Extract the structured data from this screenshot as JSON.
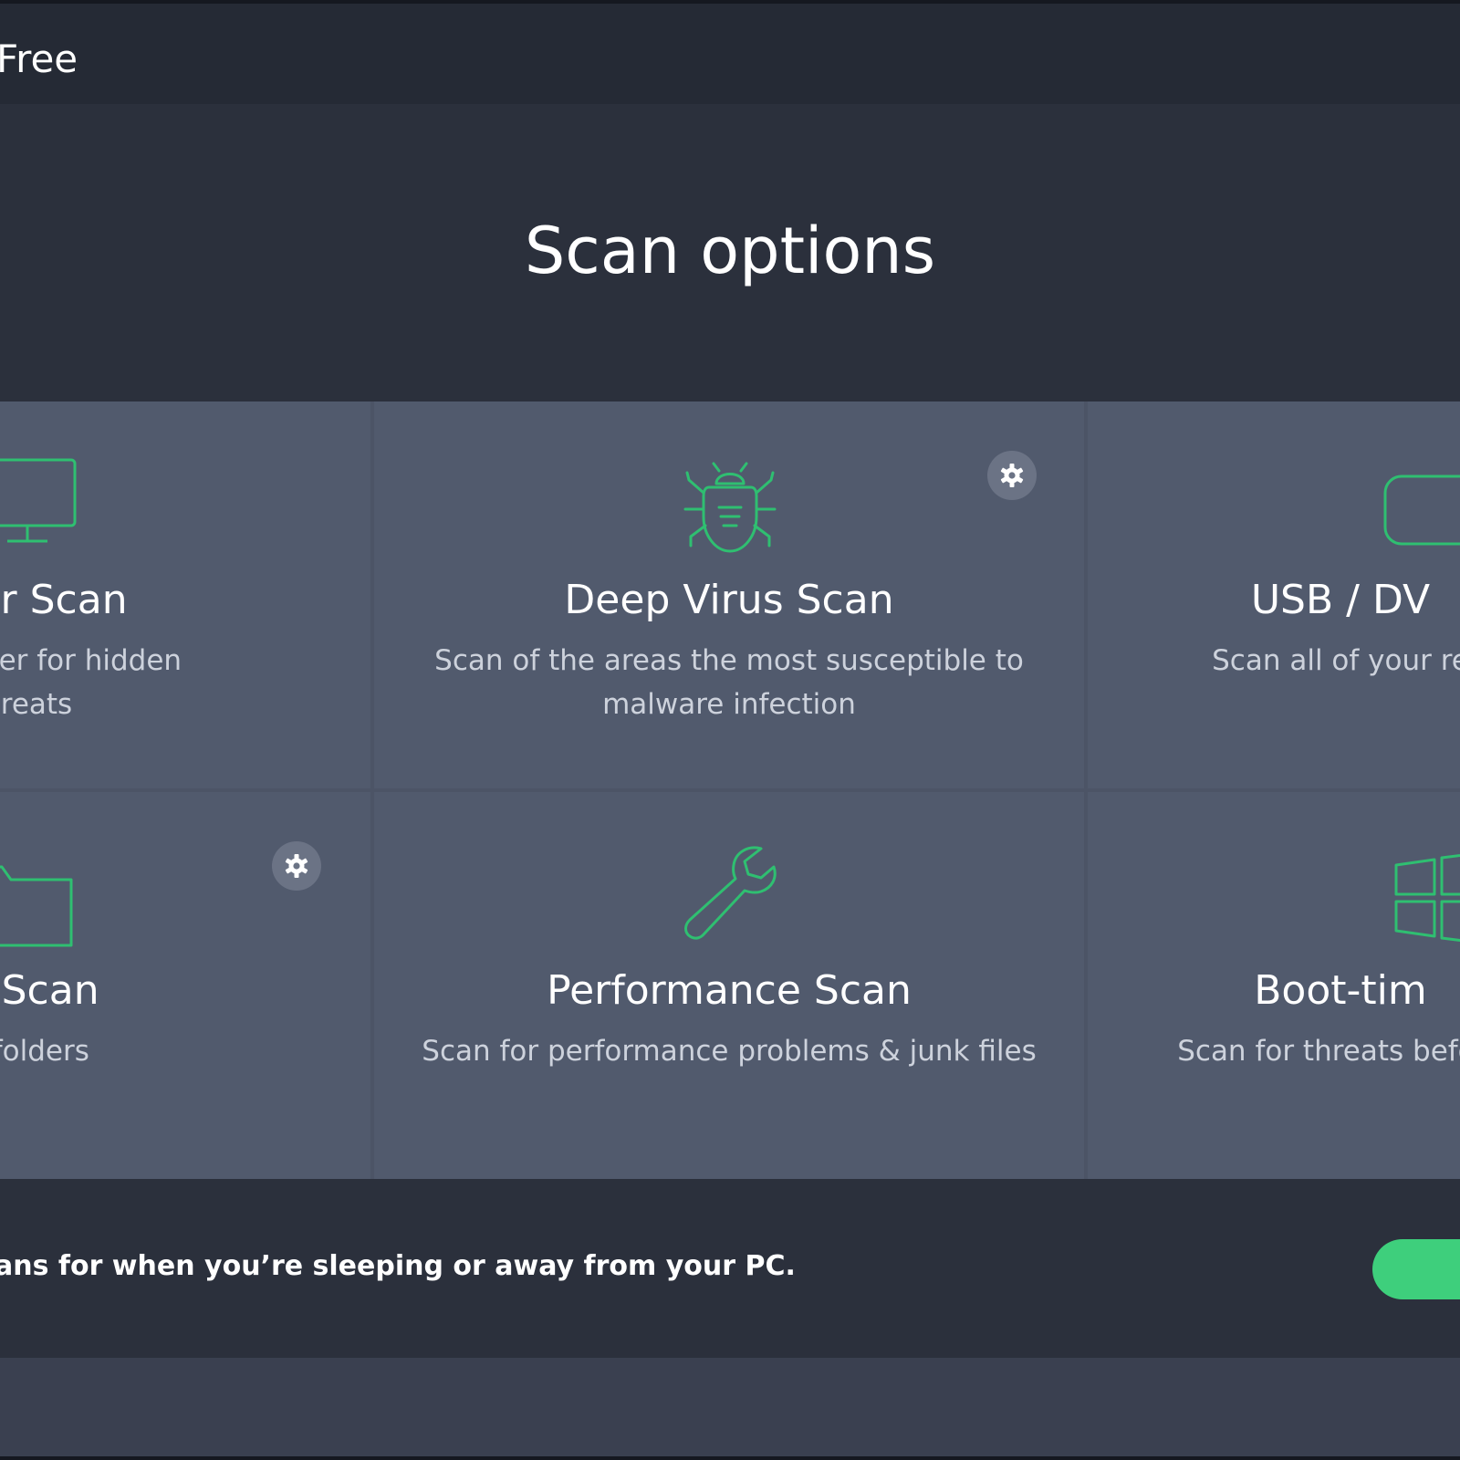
{
  "window": {
    "title": "Free"
  },
  "page": {
    "heading": "Scan options"
  },
  "tiles": [
    {
      "title": "puter Scan",
      "description": "computer for hidden\nreats",
      "icon": "monitor-icon",
      "settings": false
    },
    {
      "title": "Deep Virus Scan",
      "description": "Scan of the areas the most susceptible to\nmalware infection",
      "icon": "bug-icon",
      "settings": true
    },
    {
      "title": "USB / DV",
      "description": "Scan all of your re",
      "icon": "usb-drive-icon",
      "settings": false
    },
    {
      "title": "older Scan",
      "description": "c files or folders",
      "icon": "folder-icon",
      "settings": true
    },
    {
      "title": "Performance Scan",
      "description": "Scan for performance problems & junk files",
      "icon": "wrench-icon",
      "settings": false
    },
    {
      "title": "Boot-tim",
      "description": "Scan for threats before",
      "icon": "windows-logo-icon",
      "settings": false
    }
  ],
  "footer": {
    "message": "ans for when you’re sleeping or away from your PC."
  },
  "colors": {
    "accent": "#3ecf7c",
    "icon_stroke": "#2fbf71",
    "window_background": "#2b303c",
    "tile_background": "#515a6d"
  }
}
